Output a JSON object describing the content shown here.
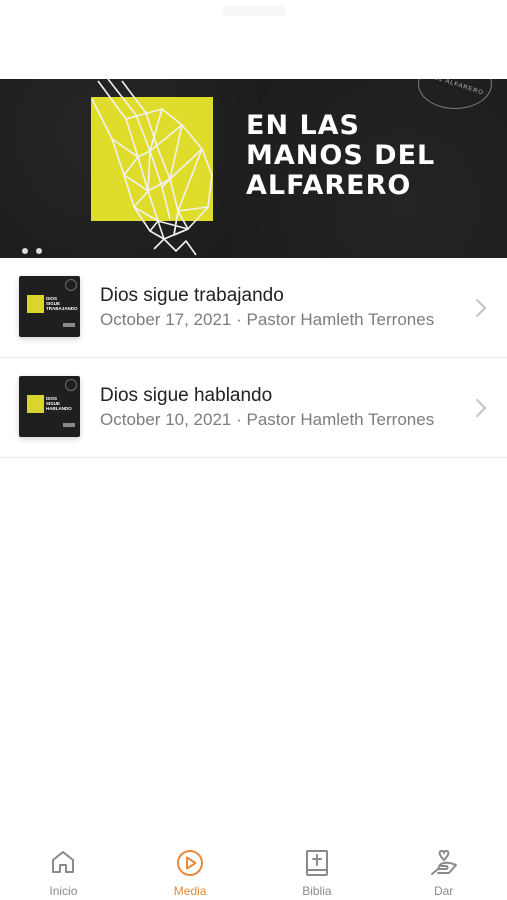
{
  "hero": {
    "title": "EN LAS\nMANOS DEL\nALFARERO",
    "ring_text": "DEL ALFARERO",
    "slides": 2
  },
  "sermons": [
    {
      "title": "Dios sigue trabajando",
      "meta": "October 17, 2021 · Pastor Hamleth Terrones",
      "thumb_text": "DIOS\nSIGUE\nTRABAJANDO"
    },
    {
      "title": "Dios sigue hablando",
      "meta": "October 10, 2021 · Pastor Hamleth Terrones",
      "thumb_text": "DIOS\nSIGUE\nHABLANDO"
    }
  ],
  "tabs": [
    {
      "label": "Inicio",
      "icon": "home-icon",
      "active": false
    },
    {
      "label": "Media",
      "icon": "play-circle-icon",
      "active": true
    },
    {
      "label": "Biblia",
      "icon": "bible-icon",
      "active": false
    },
    {
      "label": "Dar",
      "icon": "giving-hand-icon",
      "active": false
    }
  ],
  "colors": {
    "accent": "#e78a3c",
    "hero_background": "#1d1d1d",
    "hero_square": "#e0dc2c",
    "inactive_tab": "#8a8a8a"
  }
}
